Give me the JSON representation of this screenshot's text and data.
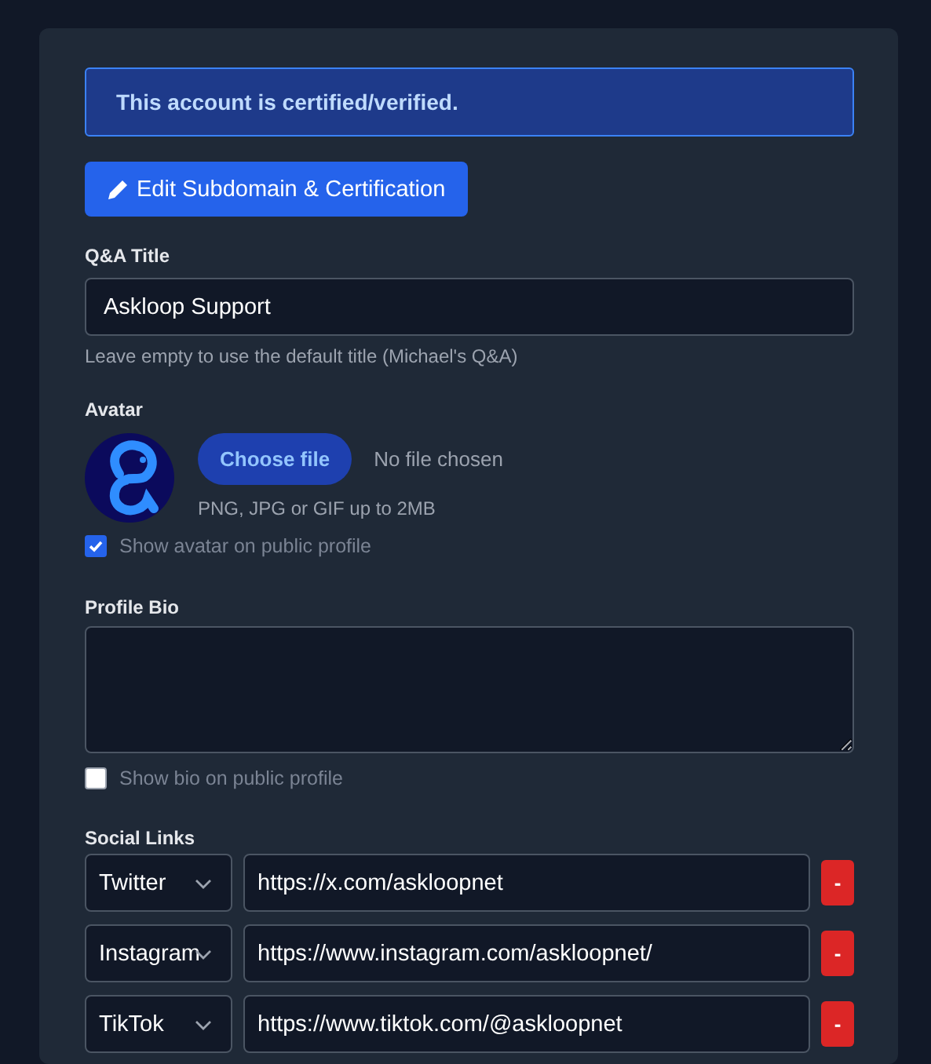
{
  "alert": {
    "text": "This account is certified/verified."
  },
  "edit_button": {
    "label": "Edit Subdomain & Certification"
  },
  "qa_title": {
    "label": "Q&A Title",
    "value": "Askloop Support",
    "hint": "Leave empty to use the default title (Michael's Q&A)"
  },
  "avatar": {
    "label": "Avatar",
    "choose_button": "Choose file",
    "file_status": "No file chosen",
    "hint": "PNG, JPG or GIF up to 2MB",
    "show_on_profile": {
      "label": "Show avatar on public profile",
      "checked": true
    }
  },
  "profile_bio": {
    "label": "Profile Bio",
    "show_on_profile": {
      "label": "Show bio on public profile",
      "checked": false
    }
  },
  "social_links": {
    "label": "Social Links",
    "rows": [
      {
        "platform": "Twitter",
        "url": "https://x.com/askloopnet",
        "remove": "-"
      },
      {
        "platform": "Instagram",
        "url": "https://www.instagram.com/askloopnet/",
        "remove": "-"
      },
      {
        "platform": "TikTok",
        "url": "https://www.tiktok.com/@askloopnet",
        "remove": "-"
      }
    ]
  }
}
